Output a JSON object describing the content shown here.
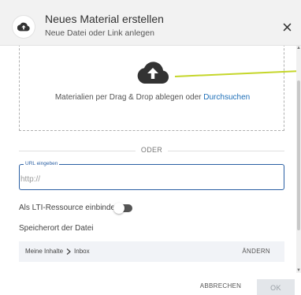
{
  "header": {
    "title": "Neues Material erstellen",
    "subtitle": "Neue Datei oder Link anlegen",
    "icon": "cloud-upload-icon",
    "close_icon": "close-icon"
  },
  "dropzone": {
    "icon": "cloud-upload-icon",
    "text": "Materialien per Drag & Drop ablegen oder",
    "link": "Durchsuchen"
  },
  "divider": {
    "label": "ODER"
  },
  "url_field": {
    "label": "URL eingeben",
    "placeholder": "http://",
    "value": ""
  },
  "lti": {
    "label": "Als LTI-Ressource einbinden",
    "enabled": false
  },
  "location": {
    "label": "Speicherort der Datei",
    "path": [
      "Meine Inhalte",
      "Inbox"
    ],
    "separator_icon": "chevron-right-icon",
    "change_label": "ÄNDERN"
  },
  "footer": {
    "cancel_label": "ABBRECHEN",
    "ok_label": "OK"
  },
  "colors": {
    "accent": "#2a5fa3",
    "link": "#1e6fb8",
    "callout": "#c5d62a",
    "header_bg": "#f2f2f2"
  }
}
